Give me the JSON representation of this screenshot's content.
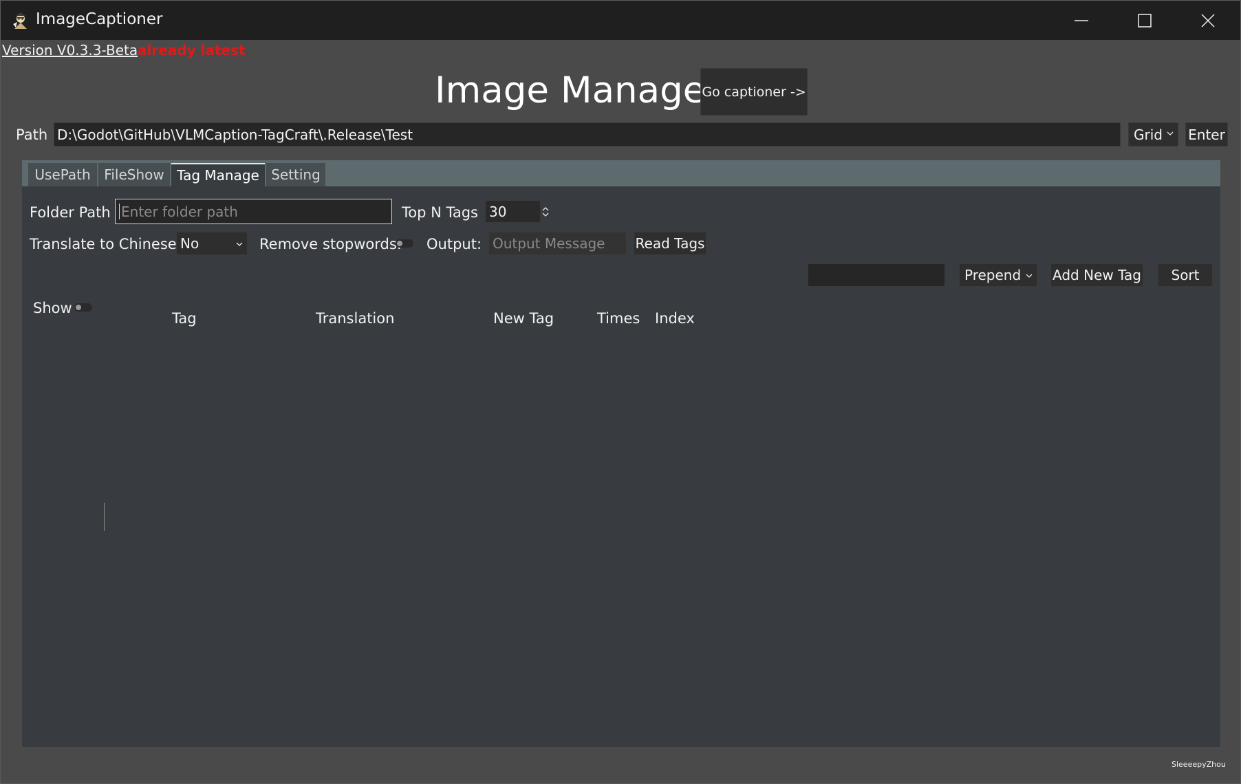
{
  "window": {
    "title": "ImageCaptioner",
    "icon": "app-icon"
  },
  "version": {
    "label": "Version V0.3.3-Beta",
    "status": "already latest",
    "status_color": "#e01a1a"
  },
  "header": {
    "title": "Image Manager",
    "go_captioner": "Go captioner ->"
  },
  "path_bar": {
    "label": "Path",
    "value": "D:\\Godot\\GitHub\\VLMCaption-TagCraft\\.Release\\Test",
    "view_mode": "Grid",
    "enter_label": "Enter"
  },
  "tabs": [
    {
      "label": "UsePath"
    },
    {
      "label": "FileShow"
    },
    {
      "label": "Tag Manage",
      "active": true
    },
    {
      "label": "Setting"
    }
  ],
  "tag_manage": {
    "folder_path_label": "Folder Path",
    "folder_path_placeholder": "Enter folder path",
    "top_n_label": "Top N Tags",
    "top_n_value": "30",
    "translate_label": "Translate to Chinese:",
    "translate_value": "No",
    "stopwords_label": "Remove stopwords:",
    "output_label": "Output:",
    "output_placeholder": "Output Message",
    "read_tags_label": "Read Tags",
    "new_tag_value": "",
    "position_mode": "Prepend",
    "add_new_tag_label": "Add New Tag",
    "sort_label": "Sort",
    "show_label": "Show",
    "columns": [
      "Tag",
      "Translation",
      "New Tag",
      "Times",
      "Index"
    ]
  },
  "footer": {
    "credit": "SleeeepyZhou"
  }
}
